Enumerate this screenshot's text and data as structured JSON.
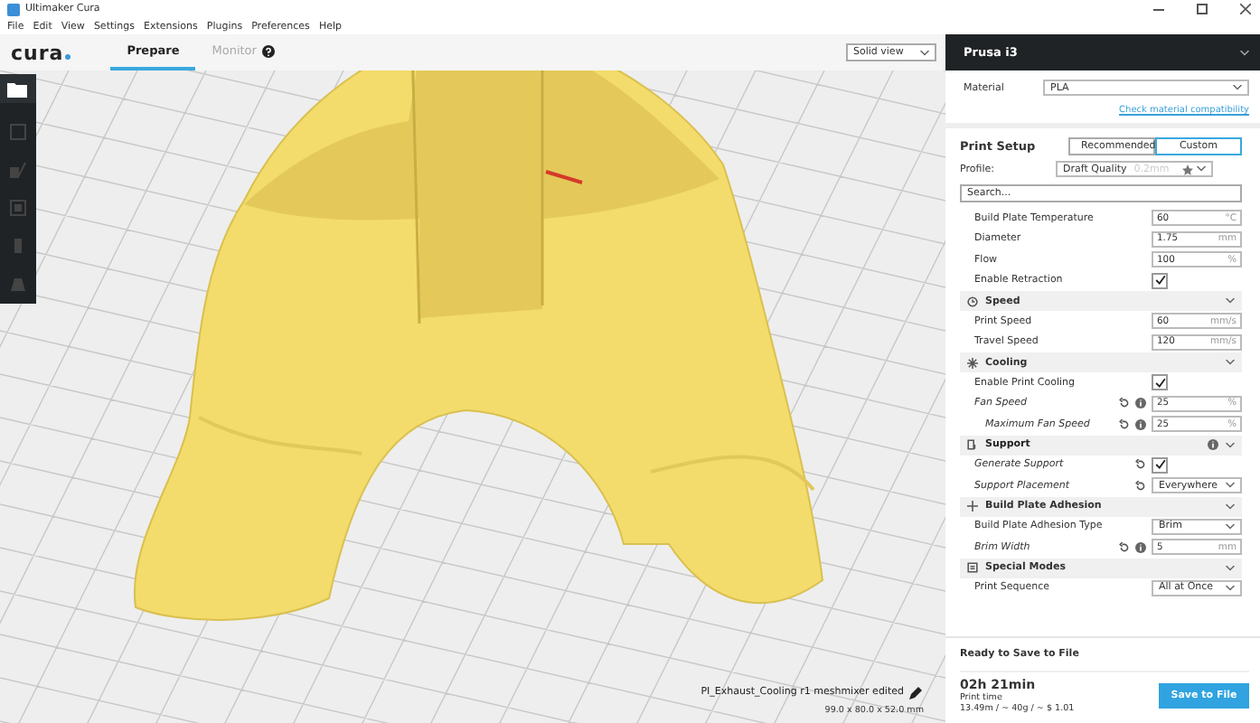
{
  "window": {
    "title": "Ultimaker Cura"
  },
  "menu": [
    "File",
    "Edit",
    "View",
    "Settings",
    "Extensions",
    "Plugins",
    "Preferences",
    "Help"
  ],
  "logo": "cura",
  "tabs": [
    {
      "label": "Prepare",
      "selected": true
    },
    {
      "label": "Monitor",
      "selected": false
    }
  ],
  "view_mode": "Solid view",
  "printer": "Prusa i3",
  "material": {
    "label": "Material",
    "value": "PLA"
  },
  "compatibility_link": "Check material compatibility",
  "print_setup": {
    "title": "Print Setup",
    "modes": [
      {
        "label": "Recommended",
        "selected": false
      },
      {
        "label": "Custom",
        "selected": true
      }
    ]
  },
  "profile": {
    "label": "Profile:",
    "value": "Draft Quality",
    "detail": "0.2mm"
  },
  "search": {
    "placeholder": "Search..."
  },
  "settings": [
    {
      "kind": "field",
      "label": "Build Plate Temperature",
      "value": "60",
      "unit": "°C",
      "modified": false
    },
    {
      "kind": "field",
      "label": "Diameter",
      "value": "1.75",
      "unit": "mm",
      "modified": false
    },
    {
      "kind": "field",
      "label": "Flow",
      "value": "100",
      "unit": "%",
      "modified": false
    },
    {
      "kind": "checkbox",
      "label": "Enable Retraction",
      "checked": true,
      "modified": false
    },
    {
      "kind": "category",
      "label": "Speed",
      "info": false
    },
    {
      "kind": "field",
      "label": "Print Speed",
      "value": "60",
      "unit": "mm/s",
      "modified": false
    },
    {
      "kind": "field",
      "label": "Travel Speed",
      "value": "120",
      "unit": "mm/s",
      "modified": false
    },
    {
      "kind": "category",
      "label": "Cooling",
      "info": false
    },
    {
      "kind": "checkbox",
      "label": "Enable Print Cooling",
      "checked": true,
      "modified": false
    },
    {
      "kind": "field",
      "label": "Fan Speed",
      "value": "25",
      "unit": "%",
      "modified": true,
      "children": [
        {
          "kind": "field",
          "label": "Maximum Fan Speed",
          "value": "25",
          "unit": "%",
          "modified": true
        }
      ]
    },
    {
      "kind": "category",
      "label": "Support",
      "info": true
    },
    {
      "kind": "checkbox",
      "label": "Generate Support",
      "checked": true,
      "modified": true
    },
    {
      "kind": "select",
      "label": "Support Placement",
      "value": "Everywhere",
      "modified": true
    },
    {
      "kind": "category",
      "label": "Build Plate Adhesion",
      "info": false
    },
    {
      "kind": "select",
      "label": "Build Plate Adhesion Type",
      "value": "Brim",
      "modified": false
    },
    {
      "kind": "field",
      "label": "Brim Width",
      "value": "5",
      "unit": "mm",
      "modified": true
    },
    {
      "kind": "category",
      "label": "Special Modes",
      "info": false
    },
    {
      "kind": "select",
      "label": "Print Sequence",
      "value": "All at Once",
      "modified": false
    }
  ],
  "model": {
    "name": "PI_Exhaust_Cooling r1 meshmixer edited",
    "dimensions": "99.0 x 80.0 x 52.0 mm"
  },
  "output": {
    "status": "Ready to Save to File",
    "time": "02h 21min",
    "time_label": "Print time",
    "estimate": "13.49m / ~ 40g / ~ $ 1.01",
    "button": "Save to File"
  }
}
